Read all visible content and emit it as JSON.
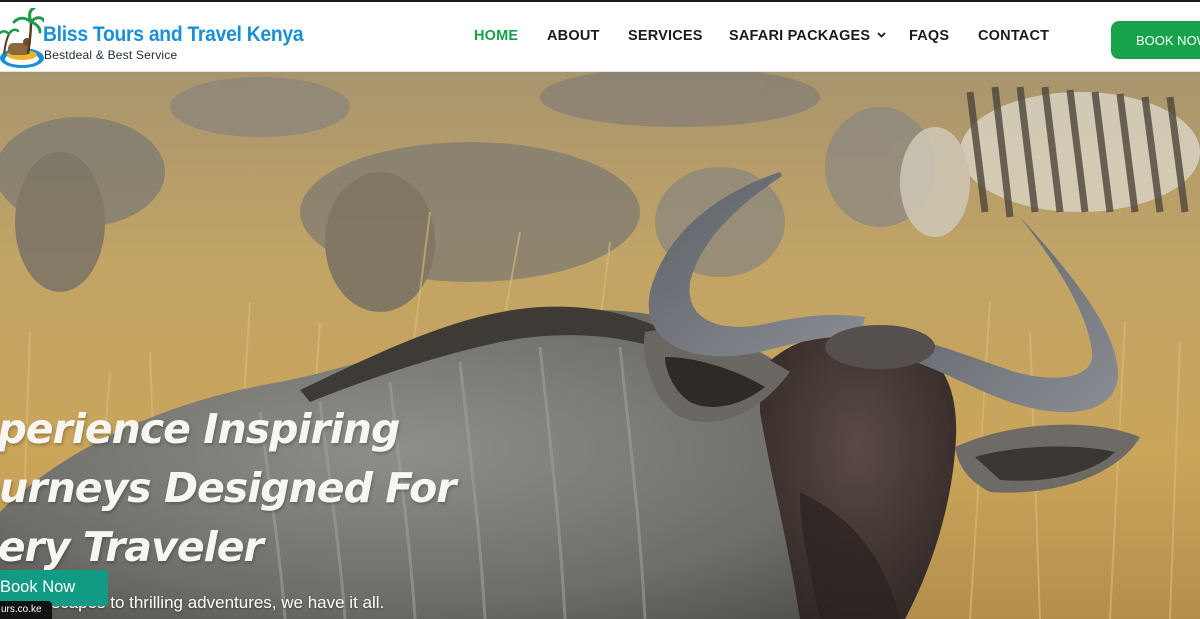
{
  "brand": {
    "title": "Bliss Tours and Travel Kenya",
    "tagline": "Bestdeal & Best Service"
  },
  "nav": {
    "items": [
      {
        "label": "HOME",
        "active": true
      },
      {
        "label": "ABOUT"
      },
      {
        "label": "SERVICES"
      },
      {
        "label": "SAFARI PACKAGES",
        "has_dropdown": true
      },
      {
        "label": "FAQS"
      },
      {
        "label": "CONTACT"
      }
    ],
    "cta_label": "BOOK NOW"
  },
  "hero": {
    "heading_lines": [
      "xperience Inspiring",
      "ourneys Designed For",
      "very Traveler"
    ],
    "subheading": "g escapes to thrilling adventures, we have it all.",
    "cta_label": "Book Now",
    "background": "wildebeest-in-savanna-grass"
  },
  "status_bar": {
    "url_fragment": "urs.co.ke"
  },
  "colors": {
    "brand_blue": "#1a8fd6",
    "accent_green": "#16a34a",
    "hero_cta_teal": "#119b85"
  },
  "icons": [
    "palm-tree-logo-icon",
    "chevron-down-icon"
  ]
}
